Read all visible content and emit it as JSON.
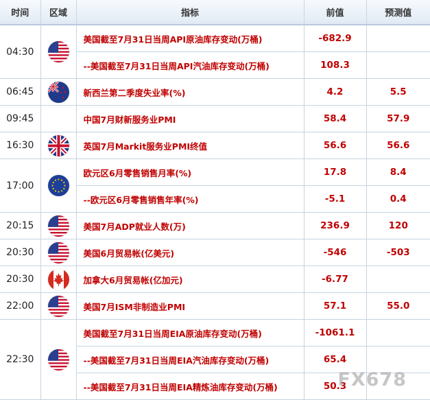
{
  "headers": {
    "time": "时间",
    "region": "区域",
    "indicator": "指标",
    "prev": "前值",
    "forecast": "预测值"
  },
  "groups": [
    {
      "time": "04:30",
      "flag": "us-flag",
      "rows": [
        {
          "indicator": "美国截至7月31日当周API原油库存变动(万桶)",
          "prev": "-682.9",
          "forecast": ""
        },
        {
          "indicator": "--美国截至7月31日当周API汽油库存变动(万桶)",
          "prev": "108.3",
          "forecast": ""
        }
      ]
    },
    {
      "time": "06:45",
      "flag": "nz-flag",
      "rows": [
        {
          "indicator": "新西兰第二季度失业率(%)",
          "prev": "4.2",
          "forecast": "5.5"
        }
      ]
    },
    {
      "time": "09:45",
      "flag": "none",
      "rows": [
        {
          "indicator": "中国7月财新服务业PMI",
          "prev": "58.4",
          "forecast": "57.9"
        }
      ]
    },
    {
      "time": "16:30",
      "flag": "uk-flag",
      "rows": [
        {
          "indicator": "英国7月Markit服务业PMI终值",
          "prev": "56.6",
          "forecast": "56.6"
        }
      ]
    },
    {
      "time": "17:00",
      "flag": "eu-flag",
      "rows": [
        {
          "indicator": "欧元区6月零售销售月率(%)",
          "prev": "17.8",
          "forecast": "8.4"
        },
        {
          "indicator": "--欧元区6月零售销售年率(%)",
          "prev": "-5.1",
          "forecast": "0.4"
        }
      ]
    },
    {
      "time": "20:15",
      "flag": "us-flag",
      "rows": [
        {
          "indicator": "美国7月ADP就业人数(万)",
          "prev": "236.9",
          "forecast": "120"
        }
      ]
    },
    {
      "time": "20:30",
      "flag": "us-flag",
      "rows": [
        {
          "indicator": "美国6月贸易帐(亿美元)",
          "prev": "-546",
          "forecast": "-503"
        }
      ]
    },
    {
      "time": "20:30",
      "flag": "ca-flag",
      "rows": [
        {
          "indicator": "加拿大6月贸易帐(亿加元)",
          "prev": "-6.77",
          "forecast": ""
        }
      ]
    },
    {
      "time": "22:00",
      "flag": "us-flag",
      "rows": [
        {
          "indicator": "美国7月ISM非制造业PMI",
          "prev": "57.1",
          "forecast": "55.0"
        }
      ]
    },
    {
      "time": "22:30",
      "flag": "us-flag",
      "rows": [
        {
          "indicator": "美国截至7月31日当周EIA原油库存变动(万桶)",
          "prev": "-1061.1",
          "forecast": ""
        },
        {
          "indicator": "--美国截至7月31日当周EIA汽油库存变动(万桶)",
          "prev": "65.4",
          "forecast": ""
        },
        {
          "indicator": "--美国截至7月31日当周EIA精炼油库存变动(万桶)",
          "prev": "50.3",
          "forecast": ""
        }
      ]
    }
  ],
  "watermark": "FX678",
  "colors": {
    "value_red": "#c00000",
    "header_bg": "#e1eaf4",
    "border": "#c7d3e2"
  }
}
